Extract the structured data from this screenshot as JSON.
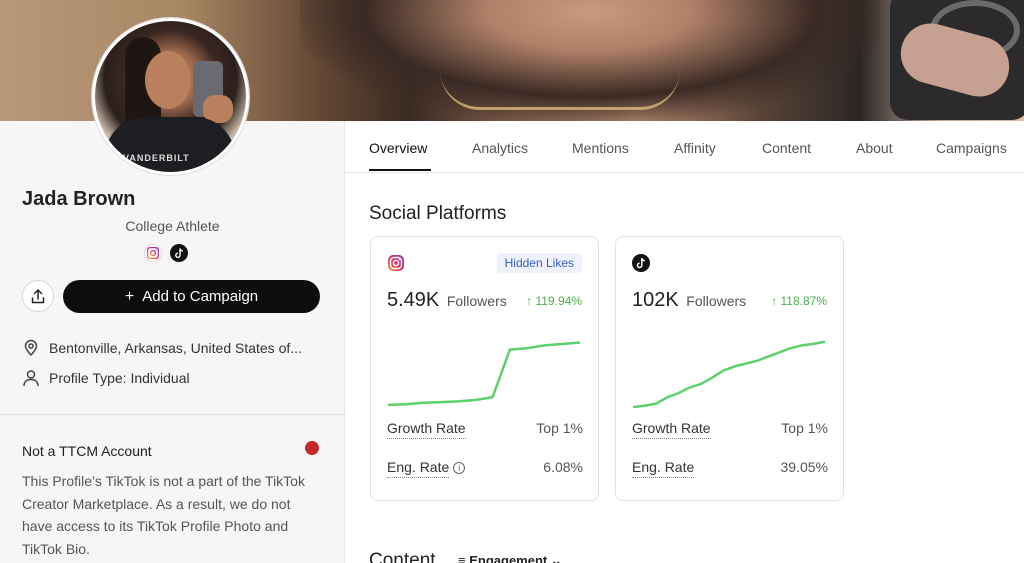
{
  "profile": {
    "name": "Jada Brown",
    "subtitle": "College Athlete",
    "shirt_text": "VANDERBILT",
    "platform_icons": [
      "instagram-icon",
      "tiktok-icon"
    ],
    "add_button_label": "Add to Campaign",
    "location": "Bentonville, Arkansas, United States of...",
    "profile_type": "Profile Type: Individual"
  },
  "ttcm": {
    "title": "Not a TTCM Account",
    "body": "This Profile’s TikTok is not a part of the TikTok Creator Marketplace. As a result, we do not have access to its TikTok Profile Photo and TikTok Bio.",
    "status_color": "#c62828"
  },
  "tabs": [
    {
      "label": "Overview",
      "active": true
    },
    {
      "label": "Analytics"
    },
    {
      "label": "Mentions"
    },
    {
      "label": "Affinity"
    },
    {
      "label": "Content"
    },
    {
      "label": "About"
    },
    {
      "label": "Campaigns"
    }
  ],
  "main": {
    "section_title": "Social Platforms",
    "content_title": "Content",
    "sort_label": "Engagement"
  },
  "platforms": [
    {
      "platform": "instagram",
      "badge": "Hidden Likes",
      "followers": "5.49K",
      "followers_unit": "Followers",
      "growth": "↑ 119.94%",
      "growth_rate_label": "Growth Rate",
      "growth_rate_value": "Top 1%",
      "eng_rate_label": "Eng. Rate",
      "eng_rate_value": "6.08%",
      "trend": [
        0.03,
        0.04,
        0.06,
        0.07,
        0.08,
        0.1,
        0.14,
        0.82,
        0.84,
        0.88,
        0.9,
        0.92
      ]
    },
    {
      "platform": "tiktok",
      "followers": "102K",
      "followers_unit": "Followers",
      "growth": "↑ 118.87%",
      "growth_rate_label": "Growth Rate",
      "growth_rate_value": "Top 1%",
      "eng_rate_label": "Eng. Rate",
      "eng_rate_value": "39.05%",
      "trend": [
        0.0,
        0.02,
        0.05,
        0.14,
        0.2,
        0.28,
        0.33,
        0.42,
        0.52,
        0.58,
        0.62,
        0.66,
        0.72,
        0.78,
        0.84,
        0.88,
        0.9,
        0.93
      ]
    }
  ],
  "colors": {
    "accent": "#0d0d0d",
    "sparkline": "#5cd16e",
    "growth": "#4caf50",
    "badge_text": "#3a5fc6"
  }
}
